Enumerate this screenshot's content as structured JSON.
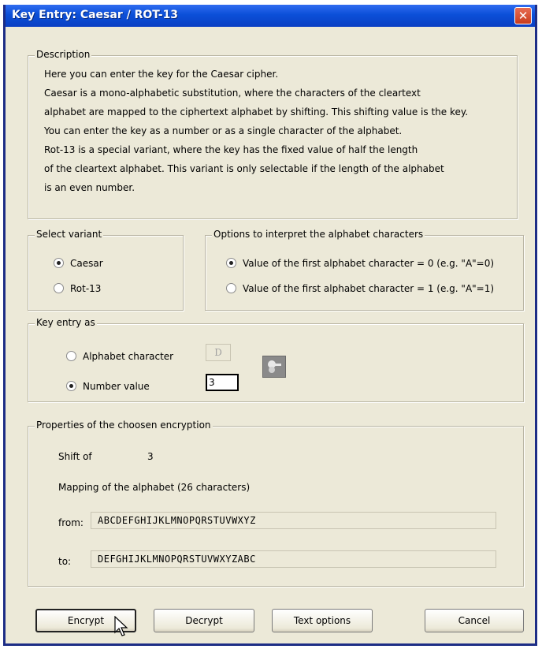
{
  "window": {
    "title": "Key Entry: Caesar / ROT-13"
  },
  "description": {
    "legend": "Description",
    "lines": [
      "Here you can enter the key for the Caesar cipher.",
      "Caesar is a mono-alphabetic substitution, where the characters of the cleartext",
      "alphabet are mapped to the ciphertext alphabet by shifting. This shifting value is the key.",
      "You can enter the key as a number or as a single character of the alphabet.",
      "Rot-13 is a special variant, where the key has the fixed value of half the length",
      "of the cleartext alphabet. This variant is only selectable if the length of the alphabet",
      "is an even number."
    ]
  },
  "variant": {
    "legend": "Select variant",
    "options": [
      {
        "label": "Caesar",
        "selected": true
      },
      {
        "label": "Rot-13",
        "selected": false
      }
    ]
  },
  "interpret": {
    "legend": "Options to interpret the alphabet characters",
    "options": [
      {
        "label": "Value of the first alphabet character = 0 (e.g. \"A\"=0)",
        "selected": true
      },
      {
        "label": "Value of the first alphabet character = 1 (e.g. \"A\"=1)",
        "selected": false
      }
    ]
  },
  "key_entry": {
    "legend": "Key entry as",
    "alphabet_label": "Alphabet character",
    "alphabet_value": "D",
    "number_label": "Number value",
    "number_value": "3",
    "alphabet_selected": false,
    "number_selected": true
  },
  "properties": {
    "legend": "Properties of the choosen encryption",
    "shift_label": "Shift of",
    "shift_value": "3",
    "mapping_label": "Mapping of the alphabet (26 characters)",
    "from_label": "from:",
    "from_value": "ABCDEFGHIJKLMNOPQRSTUVWXYZ",
    "to_label": "to:",
    "to_value": "DEFGHIJKLMNOPQRSTUVWXYZABC"
  },
  "buttons": {
    "encrypt": "Encrypt",
    "decrypt": "Decrypt",
    "text_options": "Text options",
    "cancel": "Cancel"
  },
  "icons": {
    "close": "close-icon",
    "paste_key": "key-icon"
  }
}
